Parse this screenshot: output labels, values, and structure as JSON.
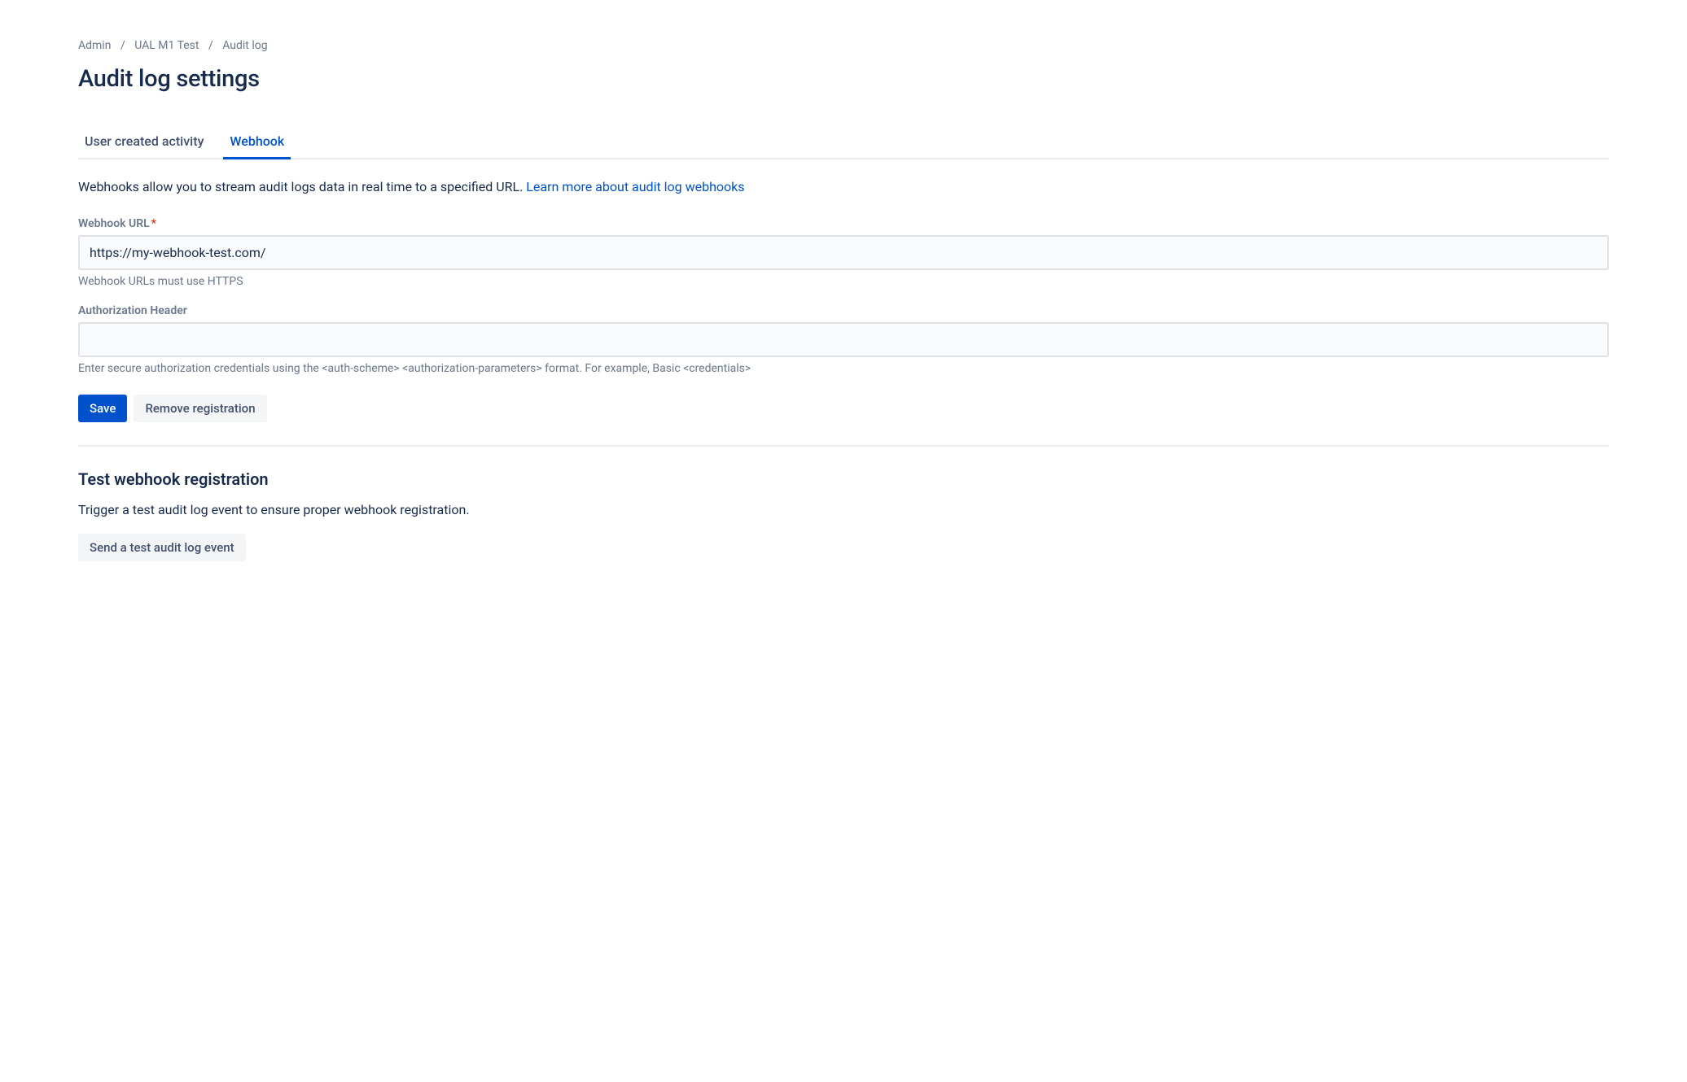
{
  "breadcrumb": {
    "items": [
      "Admin",
      "UAL M1 Test",
      "Audit log"
    ]
  },
  "page_title": "Audit log settings",
  "tabs": [
    {
      "label": "User created activity",
      "active": false
    },
    {
      "label": "Webhook",
      "active": true
    }
  ],
  "description": {
    "text": "Webhooks allow you to stream audit logs data in real time to a specified URL. ",
    "link_text": "Learn more about audit log webhooks"
  },
  "form": {
    "webhook_url": {
      "label": "Webhook URL",
      "required": true,
      "value": "https://my-webhook-test.com/",
      "help": "Webhook URLs must use HTTPS"
    },
    "auth_header": {
      "label": "Authorization Header",
      "value": "",
      "help": "Enter secure authorization credentials using the <auth-scheme> <authorization-parameters> format. For example, Basic <credentials>"
    }
  },
  "buttons": {
    "save": "Save",
    "remove": "Remove registration"
  },
  "test_section": {
    "title": "Test webhook registration",
    "description": "Trigger a test audit log event to ensure proper webhook registration.",
    "button": "Send a test audit log event"
  }
}
